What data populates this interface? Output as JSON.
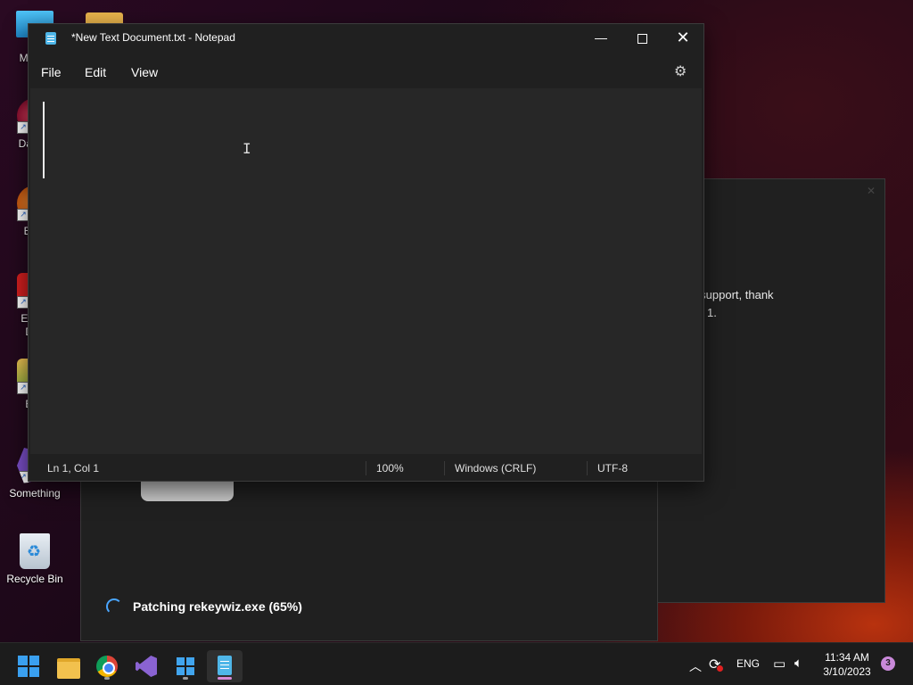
{
  "desktop": {
    "icons": [
      {
        "label": "My Co",
        "icon": "computer-icon"
      },
      {
        "label": "DataW",
        "icon": "datawizard-icon"
      },
      {
        "label": "Ever",
        "icon": "everything-icon"
      },
      {
        "label": "Emba Dev",
        "icon": "embarcadero-icon"
      },
      {
        "label": "Bad",
        "icon": "bad-app-icon"
      },
      {
        "label": "Something",
        "icon": "visual-studio-icon"
      },
      {
        "label": "Recycle Bin",
        "icon": "recycle-bin-icon"
      }
    ]
  },
  "installer": {
    "text_line1": "ur support, thank",
    "text_line2": "1.",
    "progress_text": "Patching rekeywiz.exe (65%)",
    "progress_percent": 65
  },
  "notepad": {
    "title": "*New Text Document.txt - Notepad",
    "menu": [
      "File",
      "Edit",
      "View"
    ],
    "editor_text": "",
    "status": {
      "position": "Ln 1, Col 1",
      "zoom": "100%",
      "line_ending": "Windows (CRLF)",
      "encoding": "UTF-8"
    }
  },
  "taskbar": {
    "apps": [
      "start-icon",
      "file-explorer-icon",
      "chrome-icon",
      "visual-studio-icon",
      "windows-store-icon",
      "notepad-icon"
    ],
    "language": "ENG",
    "time": "11:34 AM",
    "date": "3/10/2023",
    "notification_count": "3"
  },
  "colors": {
    "accent": "#4aa6ff",
    "notepad_bg": "#202020",
    "taskbar_bg": "#1c1c1c"
  }
}
